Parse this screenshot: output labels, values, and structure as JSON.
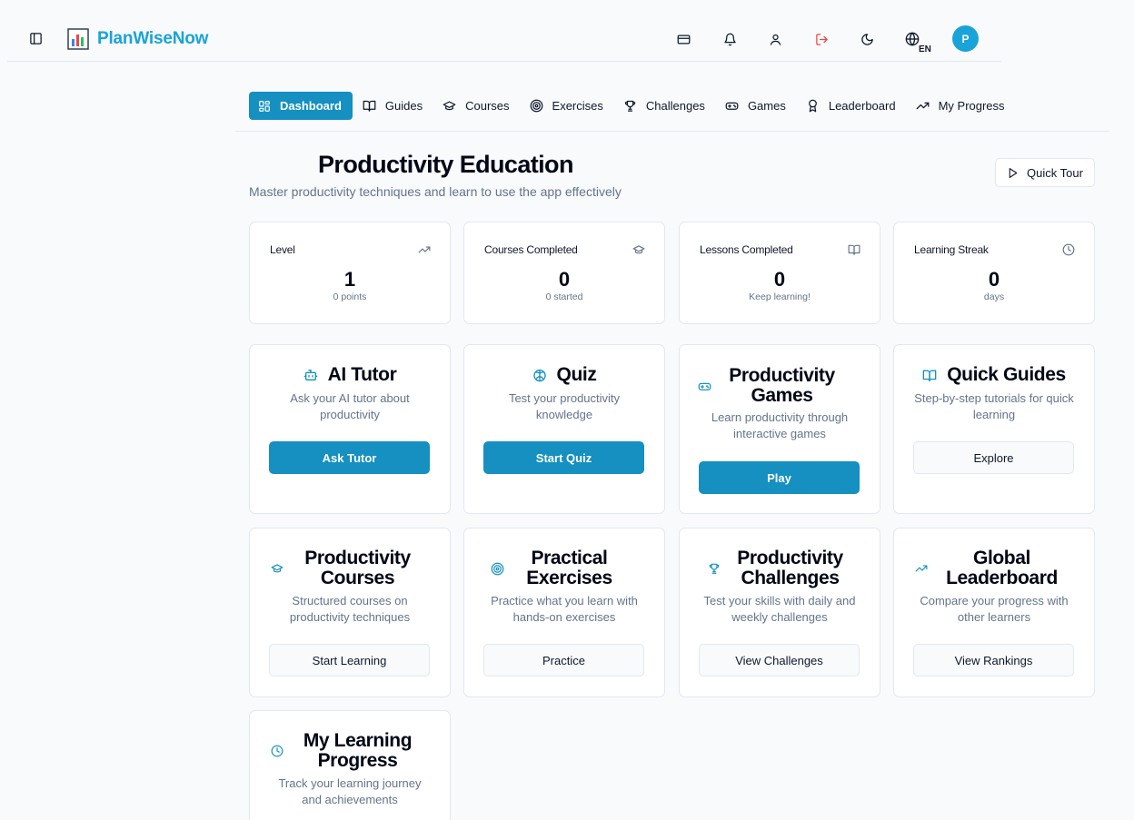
{
  "app": {
    "brand": "PlanWiseNow",
    "avatar_letter": "P",
    "language": "EN"
  },
  "header_icons": [
    "sidebar-toggle-icon",
    "card-icon",
    "bell-icon",
    "user-icon",
    "logout-icon",
    "moon-icon",
    "globe-icon"
  ],
  "tabs": [
    {
      "label": "Dashboard",
      "icon": "grid-icon",
      "active": true
    },
    {
      "label": "Guides",
      "icon": "book-icon"
    },
    {
      "label": "Courses",
      "icon": "graduation-cap-icon"
    },
    {
      "label": "Exercises",
      "icon": "target-icon"
    },
    {
      "label": "Challenges",
      "icon": "trophy-icon"
    },
    {
      "label": "Games",
      "icon": "gamepad-icon"
    },
    {
      "label": "Leaderboard",
      "icon": "award-icon"
    },
    {
      "label": "My Progress",
      "icon": "trending-up-icon"
    }
  ],
  "page": {
    "title": "Productivity Education",
    "subtitle": "Master productivity techniques and learn to use the app effectively",
    "quick_tour": "Quick Tour"
  },
  "stats": [
    {
      "label": "Level",
      "value": "1",
      "sub": "0 points",
      "icon": "trending-up-icon"
    },
    {
      "label": "Courses Completed",
      "value": "0",
      "sub": "0 started",
      "icon": "graduation-cap-icon"
    },
    {
      "label": "Lessons Completed",
      "value": "0",
      "sub": "Keep learning!",
      "icon": "book-icon"
    },
    {
      "label": "Learning Streak",
      "value": "0",
      "sub": "days",
      "icon": "clock-icon"
    }
  ],
  "features": [
    {
      "title": "AI Tutor",
      "desc": "Ask your AI tutor about productivity",
      "button": "Ask Tutor",
      "icon": "bot-icon"
    },
    {
      "title": "Quiz",
      "desc": "Test your productivity knowledge",
      "button": "Start Quiz",
      "icon": "brain-icon"
    },
    {
      "title": "Productivity Games",
      "desc": "Learn productivity through interactive games",
      "button": "Play",
      "icon": "gamepad-icon"
    },
    {
      "title": "Quick Guides",
      "desc": "Step-by-step tutorials for quick learning",
      "button": "Explore",
      "icon": "book-icon"
    },
    {
      "title": "Productivity Courses",
      "desc": "Structured courses on productivity techniques",
      "button": "Start Learning",
      "icon": "graduation-cap-icon"
    },
    {
      "title": "Practical Exercises",
      "desc": "Practice what you learn with hands-on exercises",
      "button": "Practice",
      "icon": "target-icon"
    },
    {
      "title": "Productivity Challenges",
      "desc": "Test your skills with daily and weekly challenges",
      "button": "View Challenges",
      "icon": "trophy-icon"
    },
    {
      "title": "Global Leaderboard",
      "desc": "Compare your progress with other learners",
      "button": "View Rankings",
      "icon": "trending-up-icon"
    },
    {
      "title": "My Learning Progress",
      "desc": "Track your learning journey and achievements",
      "button": "",
      "icon": "clock-icon"
    }
  ],
  "colors": {
    "accent": "#1590c0",
    "brand": "#1aa3d9",
    "logout": "#ef4444"
  }
}
